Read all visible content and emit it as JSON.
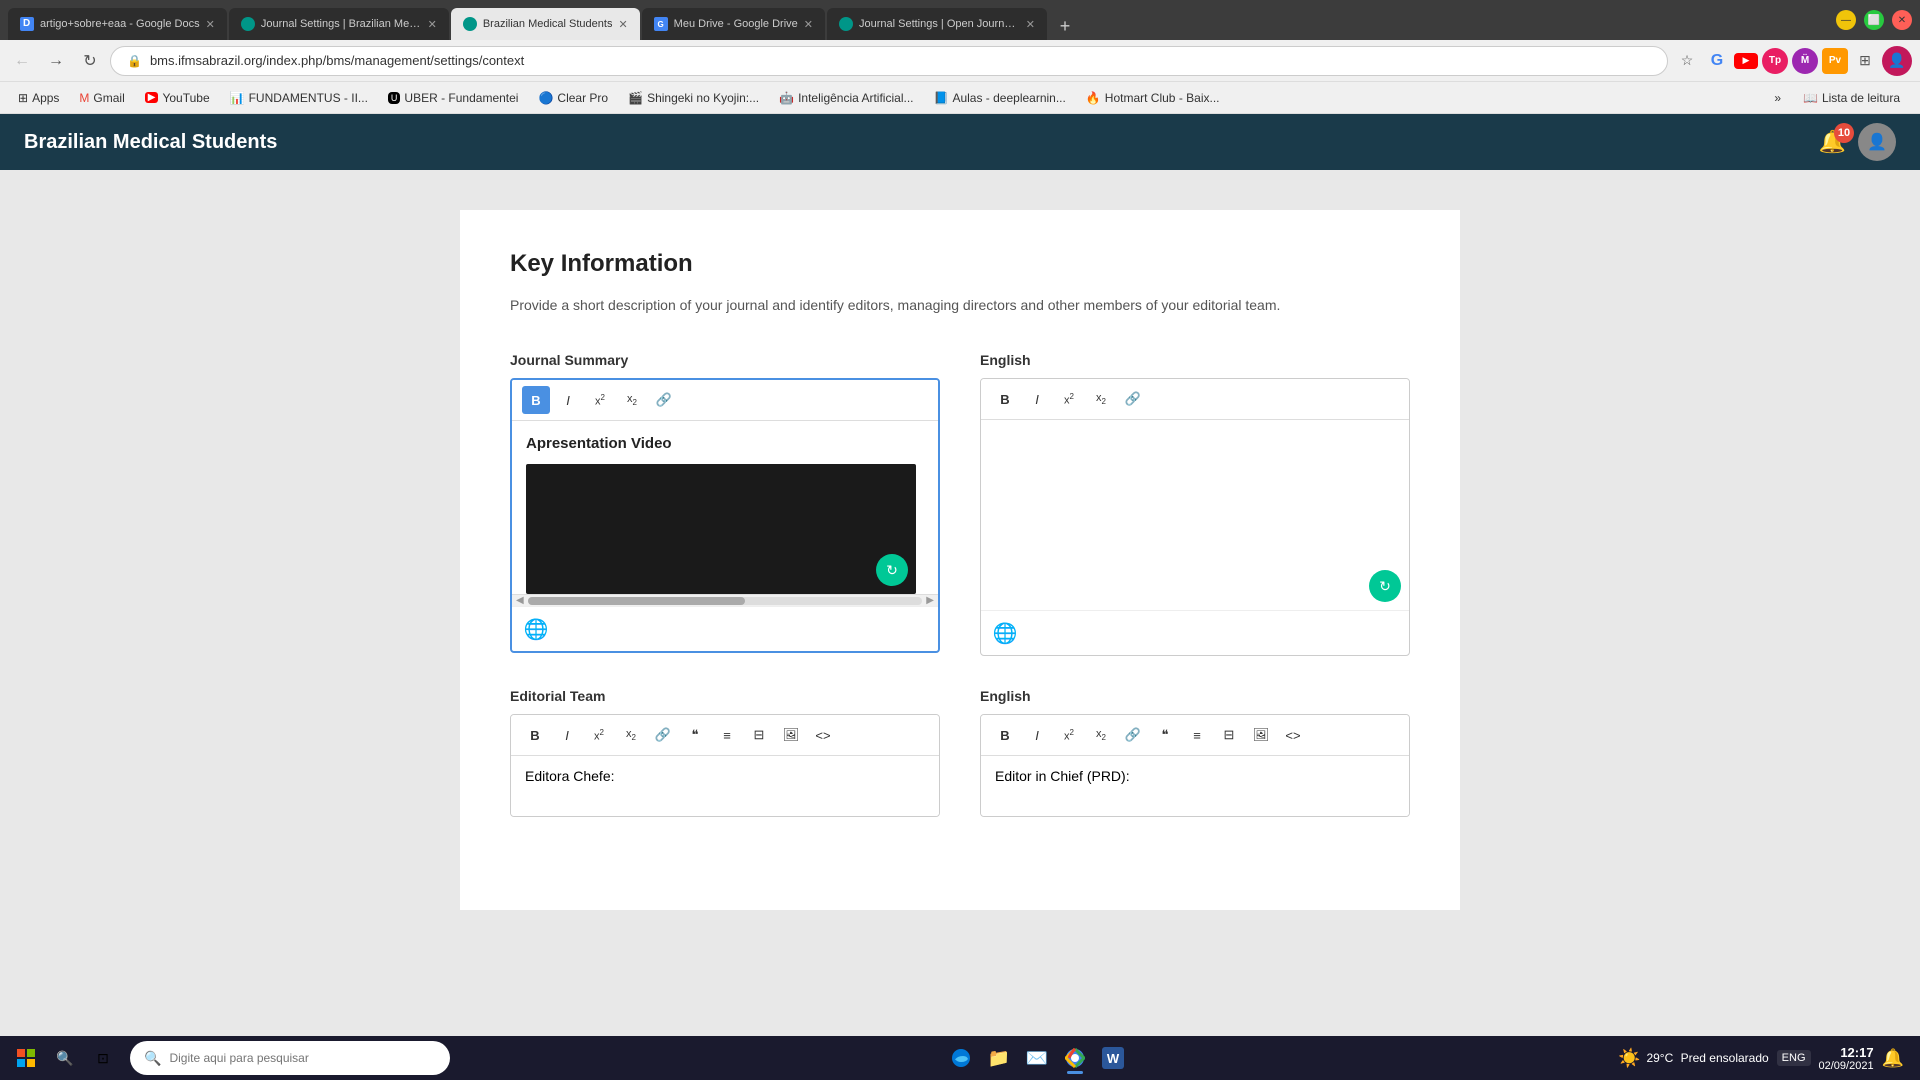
{
  "browser": {
    "tabs": [
      {
        "id": "tab1",
        "title": "artigo+sobre+eaa - Google Docs",
        "favicon_color": "#4285f4",
        "active": false
      },
      {
        "id": "tab2",
        "title": "Journal Settings | Brazilian Medi...",
        "favicon_color": "#009688",
        "active": false
      },
      {
        "id": "tab3",
        "title": "Brazilian Medical Students",
        "favicon_color": "#009688",
        "active": true
      },
      {
        "id": "tab4",
        "title": "Meu Drive - Google Drive",
        "favicon_color": "#4285f4",
        "active": false
      },
      {
        "id": "tab5",
        "title": "Journal Settings | Open Journal S...",
        "favicon_color": "#009688",
        "active": false
      }
    ],
    "address": "bms.ifmsabrazil.org/index.php/bms/management/settings/context",
    "bookmarks": [
      {
        "label": "Apps",
        "icon": "grid"
      },
      {
        "label": "Gmail",
        "icon": "mail",
        "color": "#ea4335"
      },
      {
        "label": "YouTube",
        "icon": "play",
        "color": "#ff0000"
      },
      {
        "label": "FUNDAMENTUS - II...",
        "icon": "chart",
        "color": "#28a745"
      },
      {
        "label": "UBER - Fundamentei",
        "icon": "uber",
        "color": "#000"
      },
      {
        "label": "Clear Pro",
        "icon": "clear",
        "color": "#333"
      },
      {
        "label": "Shingeki no Kyojin:...",
        "icon": "movie",
        "color": "#9c27b0"
      },
      {
        "label": "Inteligência Artificial...",
        "icon": "ai",
        "color": "#ff5722"
      },
      {
        "label": "Aulas - deeplearnin...",
        "icon": "book",
        "color": "#2196f3"
      },
      {
        "label": "Hotmart Club - Baix...",
        "icon": "hotmart",
        "color": "#e91e63"
      }
    ],
    "overflow_label": "»",
    "reading_list_label": "Lista de leitura"
  },
  "app_header": {
    "title": "Brazilian Medical Students",
    "notification_count": "10"
  },
  "page": {
    "title": "Key Information",
    "description": "Provide a short description of your journal and identify editors, managing directors and other members of your editorial team."
  },
  "journal_summary": {
    "label": "Journal Summary",
    "toolbar": {
      "bold": "B",
      "italic": "I",
      "superscript": "x²",
      "subscript": "x₂",
      "link": "🔗"
    },
    "content_title": "Apresentation Video"
  },
  "english_summary": {
    "label": "English",
    "toolbar": {
      "bold": "B",
      "italic": "I",
      "superscript": "x²",
      "subscript": "x₂",
      "link": "🔗"
    }
  },
  "editorial_team": {
    "label": "Editorial Team",
    "english_label": "English",
    "toolbar_items": [
      "B",
      "I",
      "x²",
      "x₂",
      "🔗",
      "❝",
      "•-",
      "=-",
      "🖼",
      "<>"
    ],
    "content": "Editora Chefe:",
    "english_content": "Editor in Chief (PRD):"
  },
  "taskbar": {
    "search_placeholder": "Digite aqui para pesquisar",
    "weather": {
      "temperature": "29°C",
      "condition": "Pred ensolarado",
      "icon": "☀️"
    },
    "clock": {
      "time": "12:17",
      "date": "02/09/2021"
    },
    "language": "ENG"
  }
}
